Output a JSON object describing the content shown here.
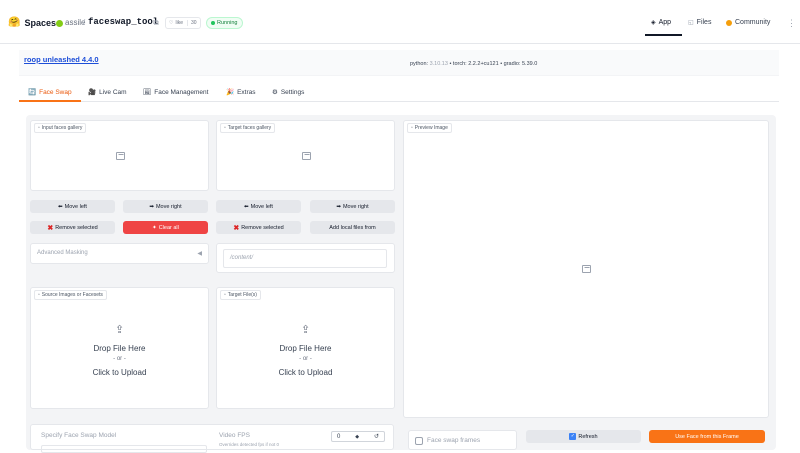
{
  "topbar": {
    "brand": "Spaces",
    "brand_icon": "hugging-face-logo",
    "owner": "assile",
    "separator": "/",
    "repo": "faceswap_tool",
    "like_label": "like",
    "like_count": "30",
    "status": "Running",
    "nav": [
      {
        "label": "App",
        "icon": "app-icon"
      },
      {
        "label": "Files",
        "icon": "files-icon"
      },
      {
        "label": "Community",
        "icon": "community-icon"
      }
    ],
    "more": "⋮"
  },
  "header": {
    "title": "roop unleashed 4.4.0",
    "python_label": "python:",
    "python_version": "3.10.13",
    "torch_label": "• torch:",
    "torch_version": "2.2.2+cu121",
    "gradio_label": "• gradio:",
    "gradio_version": "5.39.0"
  },
  "tabs": [
    {
      "label": "Face Swap",
      "icon": "🔄",
      "active": true
    },
    {
      "label": "Live Cam",
      "icon": "🎥"
    },
    {
      "label": "Face Management",
      "icon": "🖼"
    },
    {
      "label": "Extras",
      "icon": "🎉"
    },
    {
      "label": "Settings",
      "icon": "⚙"
    }
  ],
  "galleries": {
    "input_label": "Input faces gallery",
    "target_label": "Target faces gallery",
    "preview_label": "Preview Image"
  },
  "buttons": {
    "move_left": "Move left",
    "move_right": "Move right",
    "remove_selected": "Remove selected",
    "clear_all": "Clear all",
    "add_local_files": "Add local files from",
    "refresh": "Refresh",
    "use_face": "Use Face from this Frame"
  },
  "advanced_masking": "Advanced Masking",
  "path_placeholder": "/content/",
  "uploads": {
    "source_label": "Source Images or Facesets",
    "target_label": "Target File(s)",
    "drop_text": "Drop File Here",
    "or_text": "- or -",
    "click_text": "Click to Upload"
  },
  "bottom": {
    "model_label": "Specify Face Swap Model",
    "fps_label": "Video FPS",
    "fps_hint": "Overrides detected fps if not 0",
    "fps_value": "0",
    "face_swap_frames": "Face swap frames"
  },
  "colors": {
    "accent": "#f97316",
    "danger": "#ef4444",
    "status_green": "#22c55e",
    "link_blue": "#1d4ed8"
  }
}
